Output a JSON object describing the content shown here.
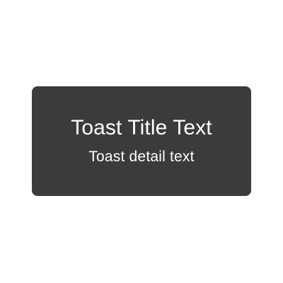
{
  "toast": {
    "title": "Toast Title Text",
    "detail": "Toast detail text"
  },
  "colors": {
    "background": "#ffffff",
    "toast_background": "#3b3b3b",
    "toast_text": "#ffffff"
  }
}
